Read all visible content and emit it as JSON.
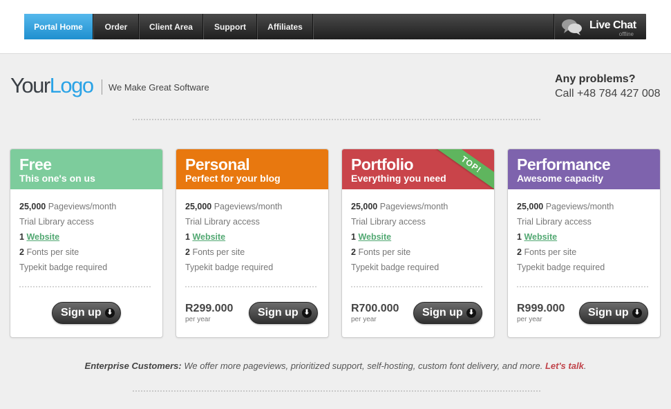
{
  "nav": {
    "items": [
      "Portal Home",
      "Order",
      "Client Area",
      "Support",
      "Affiliates"
    ],
    "live_chat": {
      "title": "Live Chat",
      "status": "offline"
    }
  },
  "brand": {
    "logo_part1": "Your",
    "logo_part2": "Logo",
    "tagline": "We Make Great Software"
  },
  "contact": {
    "title": "Any problems?",
    "phone": "Call +48 784 427 008"
  },
  "plans": [
    {
      "name": "Free",
      "subtitle": "This one's on us",
      "color": "#7dcc9c",
      "features": {
        "pageviews_num": "25,000",
        "pageviews_label": "Pageviews/month",
        "library": "Trial Library access",
        "website_num": "1",
        "website_label": "Website",
        "fonts_num": "2",
        "fonts_label": "Fonts per site",
        "badge": "Typekit badge required"
      },
      "price": "",
      "price_period": "",
      "signup_label": "Sign up",
      "ribbon": ""
    },
    {
      "name": "Personal",
      "subtitle": "Perfect for your blog",
      "color": "#e8780f",
      "features": {
        "pageviews_num": "25,000",
        "pageviews_label": "Pageviews/month",
        "library": "Trial Library access",
        "website_num": "1",
        "website_label": "Website",
        "fonts_num": "2",
        "fonts_label": "Fonts per site",
        "badge": "Typekit badge required"
      },
      "price": "R299.000",
      "price_period": "per year",
      "signup_label": "Sign up",
      "ribbon": ""
    },
    {
      "name": "Portfolio",
      "subtitle": "Everything you need",
      "color": "#c9444a",
      "features": {
        "pageviews_num": "25,000",
        "pageviews_label": "Pageviews/month",
        "library": "Trial Library access",
        "website_num": "1",
        "website_label": "Website",
        "fonts_num": "2",
        "fonts_label": "Fonts per site",
        "badge": "Typekit badge required"
      },
      "price": "R700.000",
      "price_period": "per year",
      "signup_label": "Sign up",
      "ribbon": "TOP!"
    },
    {
      "name": "Performance",
      "subtitle": "Awesome capacity",
      "color": "#7e63ad",
      "features": {
        "pageviews_num": "25,000",
        "pageviews_label": "Pageviews/month",
        "library": "Trial Library access",
        "website_num": "1",
        "website_label": "Website",
        "fonts_num": "2",
        "fonts_label": "Fonts per site",
        "badge": "Typekit badge required"
      },
      "price": "R999.000",
      "price_period": "per year",
      "signup_label": "Sign up",
      "ribbon": ""
    }
  ],
  "enterprise": {
    "lead": "Enterprise Customers:",
    "text": " We offer more pageviews, prioritized support, self-hosting, custom font delivery, and more. ",
    "link": "Let's talk",
    "end": "."
  },
  "icons": {
    "chat": "chat-bubbles-icon",
    "signup_arrow": "arrow-down-circle-icon"
  }
}
